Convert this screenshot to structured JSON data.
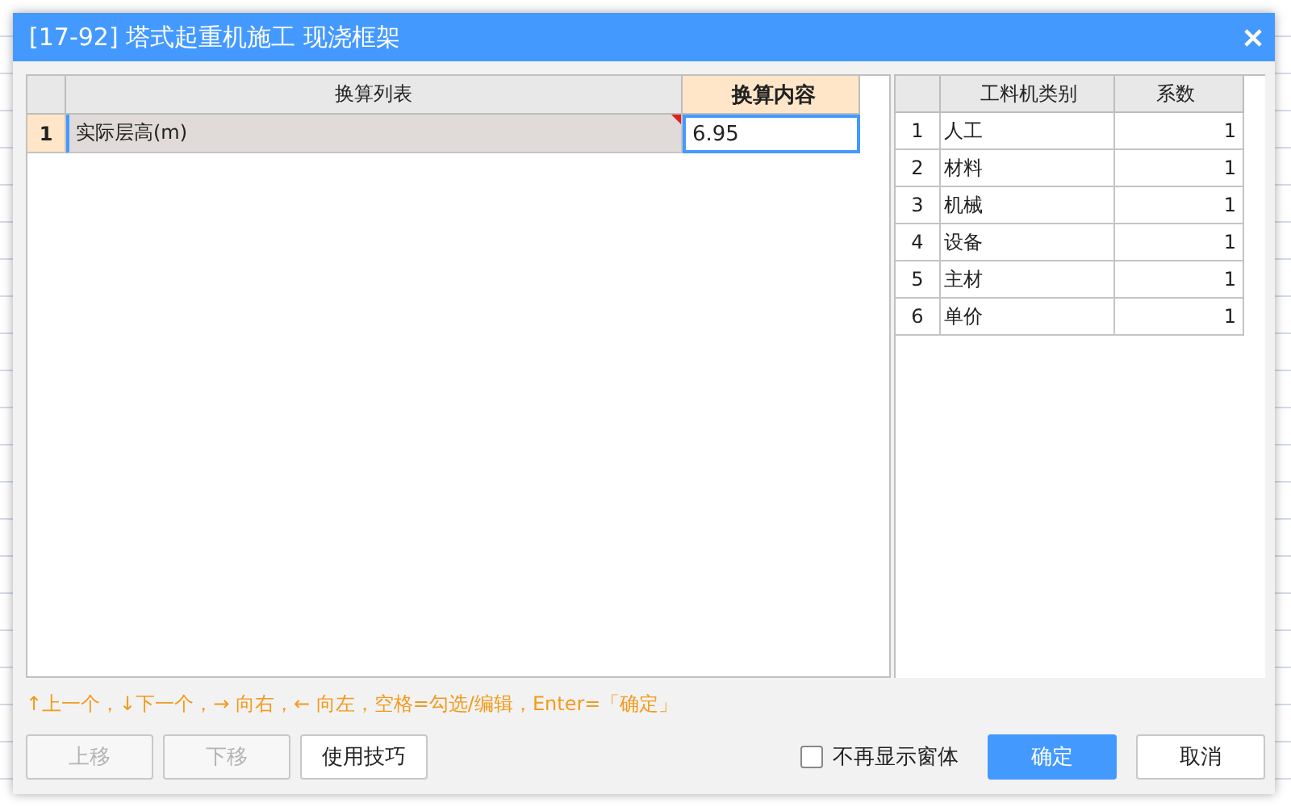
{
  "dialog": {
    "title": "[17-92] 塔式起重机施工 现浇框架"
  },
  "conversion_table": {
    "columns": [
      "换算列表",
      "换算内容"
    ],
    "rows": [
      {
        "number": "1",
        "name": "实际层高(m)",
        "value": "6.95",
        "selected": true
      }
    ]
  },
  "factor_table": {
    "columns": [
      "工料机类别",
      "系数"
    ],
    "rows": [
      {
        "number": "1",
        "name": "人工",
        "factor": "1"
      },
      {
        "number": "2",
        "name": "材料",
        "factor": "1"
      },
      {
        "number": "3",
        "name": "机械",
        "factor": "1"
      },
      {
        "number": "4",
        "name": "设备",
        "factor": "1"
      },
      {
        "number": "5",
        "name": "主材",
        "factor": "1"
      },
      {
        "number": "6",
        "name": "单价",
        "factor": "1"
      }
    ]
  },
  "hint": "↑上一个，↓下一个，→ 向右，← 向左，空格=勾选/编辑，Enter=「确定」",
  "buttons": [
    {
      "label": "上移",
      "disabled": true
    },
    {
      "label": "下移",
      "disabled": true
    },
    {
      "label": "使用技巧",
      "disabled": false
    }
  ],
  "dont_show_again": {
    "label": "不再显示窗体",
    "checked": false
  },
  "actions": [
    {
      "label": "确定",
      "kind": "primary"
    },
    {
      "label": "取消",
      "kind": "secondary"
    }
  ]
}
